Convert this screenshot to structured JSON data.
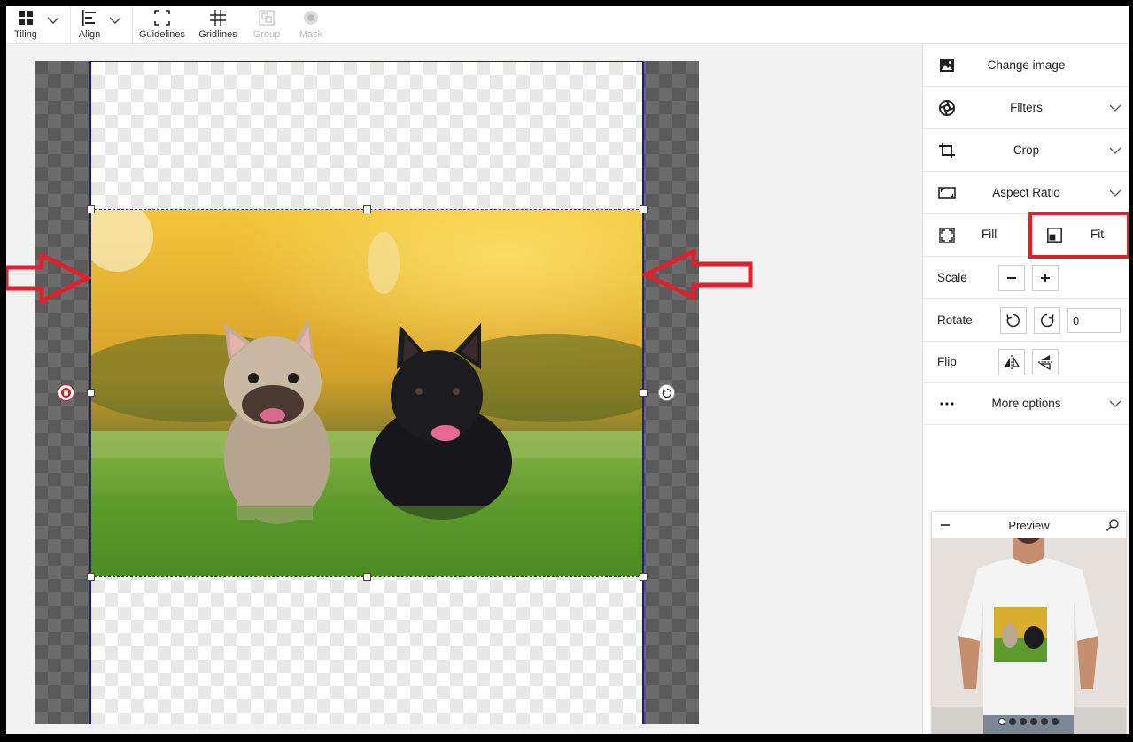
{
  "toolbar": {
    "tiling": "Tiling",
    "align": "Align",
    "guidelines": "Guidelines",
    "gridlines": "Gridlines",
    "group": "Group",
    "mask": "Mask"
  },
  "panel": {
    "change_image": "Change image",
    "filters": "Filters",
    "crop": "Crop",
    "aspect_ratio": "Aspect Ratio",
    "fill": "Fill",
    "fit": "Fit",
    "scale": "Scale",
    "rotate": "Rotate",
    "rotate_value": "0",
    "flip": "Flip",
    "more_options": "More options"
  },
  "preview": {
    "title": "Preview",
    "dots_count": 6
  },
  "colors": {
    "highlight_red": "#e0202a",
    "print_area_border": "#1a1a8c"
  }
}
